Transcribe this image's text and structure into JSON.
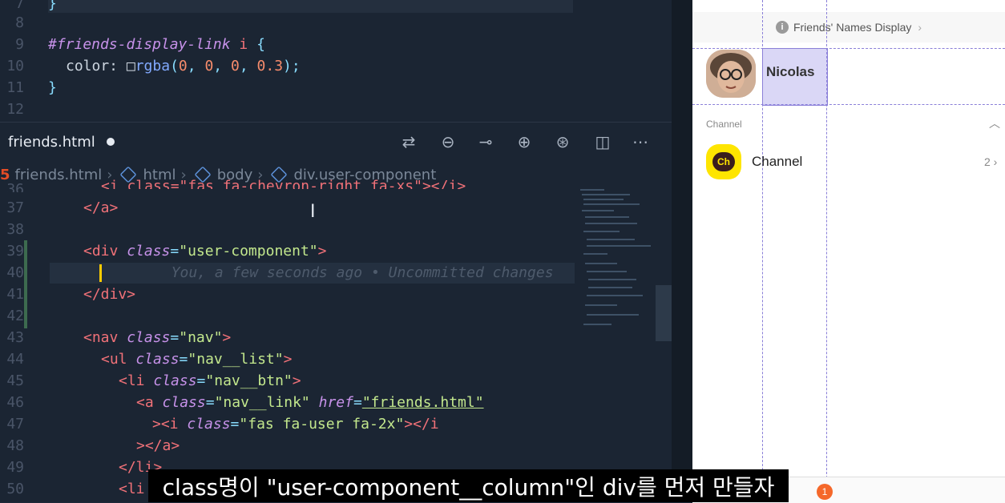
{
  "top_pane": {
    "lines": [
      {
        "num": "7",
        "text": "}"
      },
      {
        "num": "8",
        "text": ""
      },
      {
        "num": "9",
        "selector": "#friends-display-link",
        "tag": "i",
        "open": "{"
      },
      {
        "num": "10",
        "prop": "color:",
        "swatch": "□",
        "fn": "rgba",
        "args": [
          "0",
          "0",
          "0",
          "0.3"
        ]
      },
      {
        "num": "11",
        "text": "}"
      },
      {
        "num": "12",
        "text": ""
      }
    ]
  },
  "tab": {
    "filename": "friends.html"
  },
  "toolbar": {
    "icons": [
      "git-compare-icon",
      "go-back-icon",
      "commit-icon",
      "go-forward-icon",
      "git-lens-icon",
      "split-editor-icon",
      "more-icon"
    ]
  },
  "breadcrumb": {
    "items": [
      "friends.html",
      "html",
      "body",
      "div.user-component"
    ]
  },
  "code": {
    "lines": [
      {
        "num": "36",
        "raw": "<i class=\"fas fa-chevron-right fa-xs\"></i>"
      },
      {
        "num": "37",
        "tag": "</a>"
      },
      {
        "num": "38"
      },
      {
        "num": "39",
        "open_tag": "<div",
        "attr": "class",
        "value": "\"user-component\"",
        "close": ">"
      },
      {
        "num": "40",
        "blame": "You, a few seconds ago • Uncommitted changes"
      },
      {
        "num": "41",
        "tag": "</div>"
      },
      {
        "num": "42"
      },
      {
        "num": "43",
        "open_tag": "<nav",
        "attr": "class",
        "value": "\"nav\"",
        "close": ">"
      },
      {
        "num": "44",
        "open_tag": "<ul",
        "attr": "class",
        "value": "\"nav__list\"",
        "close": ">"
      },
      {
        "num": "45",
        "open_tag": "<li",
        "attr": "class",
        "value": "\"nav__btn\"",
        "close": ">"
      },
      {
        "num": "46",
        "open_tag": "<a",
        "attr": "class",
        "value": "\"nav__link\"",
        "attr2": "href",
        "value2": "\"friends.html\""
      },
      {
        "num": "47",
        "open_tag": "><i",
        "attr": "class",
        "value": "\"fas fa-user fa-2x\"",
        "close": "></i"
      },
      {
        "num": "48",
        "tag": "></a>"
      },
      {
        "num": "49",
        "tag": "</li>"
      },
      {
        "num": "50",
        "tag": "<li"
      }
    ]
  },
  "preview": {
    "header_title": "Friends' Names Display",
    "user_name": "Nicolas",
    "channel_section": "Channel",
    "channel_label": "Channel",
    "channel_count": "2",
    "badge": "1"
  },
  "subtitle": "class명이 \"user-component__column\"인 div를 먼저 만들자",
  "colors": {
    "editor_bg": "#1b2533",
    "accent_purple": "#8a7fd8",
    "kakao_yellow": "#fee500"
  }
}
